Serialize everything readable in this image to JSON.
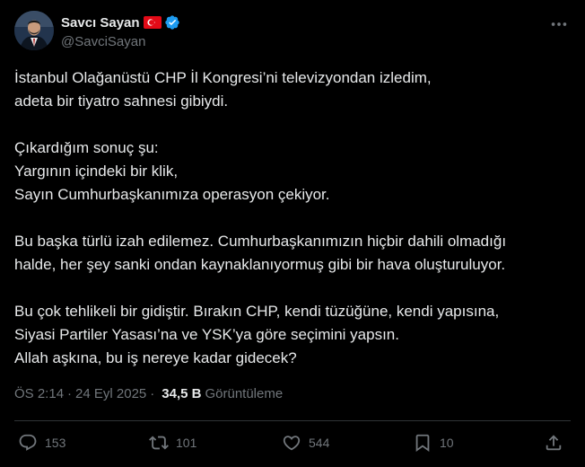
{
  "author": {
    "display_name": "Savcı Sayan",
    "handle": "@SavciSayan",
    "flag_icon": "turkey-flag-icon",
    "verified_icon": "verified-badge-icon",
    "verified_color": "#1d9bf0"
  },
  "tweet": {
    "lines": [
      "İstanbul Olağanüstü CHP İl Kongresi’ni televizyondan izledim,",
      "adeta bir tiyatro sahnesi gibiydi.",
      "",
      "Çıkardığım sonuç şu:",
      "Yargının içindeki bir klik,",
      "Sayın Cumhurbaşkanımıza operasyon çekiyor.",
      "",
      "Bu başka türlü izah edilemez. Cumhurbaşkanımızın hiçbir dahili olmadığı",
      "halde, her şey sanki ondan kaynaklanıyormuş gibi bir hava oluşturuluyor.",
      "",
      "Bu çok tehlikeli bir gidiştir. Bırakın CHP, kendi tüzüğüne, kendi yapısına,",
      "Siyasi Partiler Yasası’na ve YSK’ya göre seçimini yapsın.",
      "Allah aşkına, bu iş nereye kadar gidecek?"
    ]
  },
  "meta": {
    "time": "ÖS 2:14",
    "separator": "·",
    "date": "24 Eyl 2025",
    "separator2": "·",
    "views": "34,5 B",
    "views_label": "Görüntüleme"
  },
  "actions": {
    "reply_count": "153",
    "retweet_count": "101",
    "like_count": "544",
    "bookmark_count": "10"
  },
  "colors": {
    "background": "#000000",
    "text": "#e7e9ea",
    "muted": "#71767b",
    "border": "#2f3336"
  }
}
